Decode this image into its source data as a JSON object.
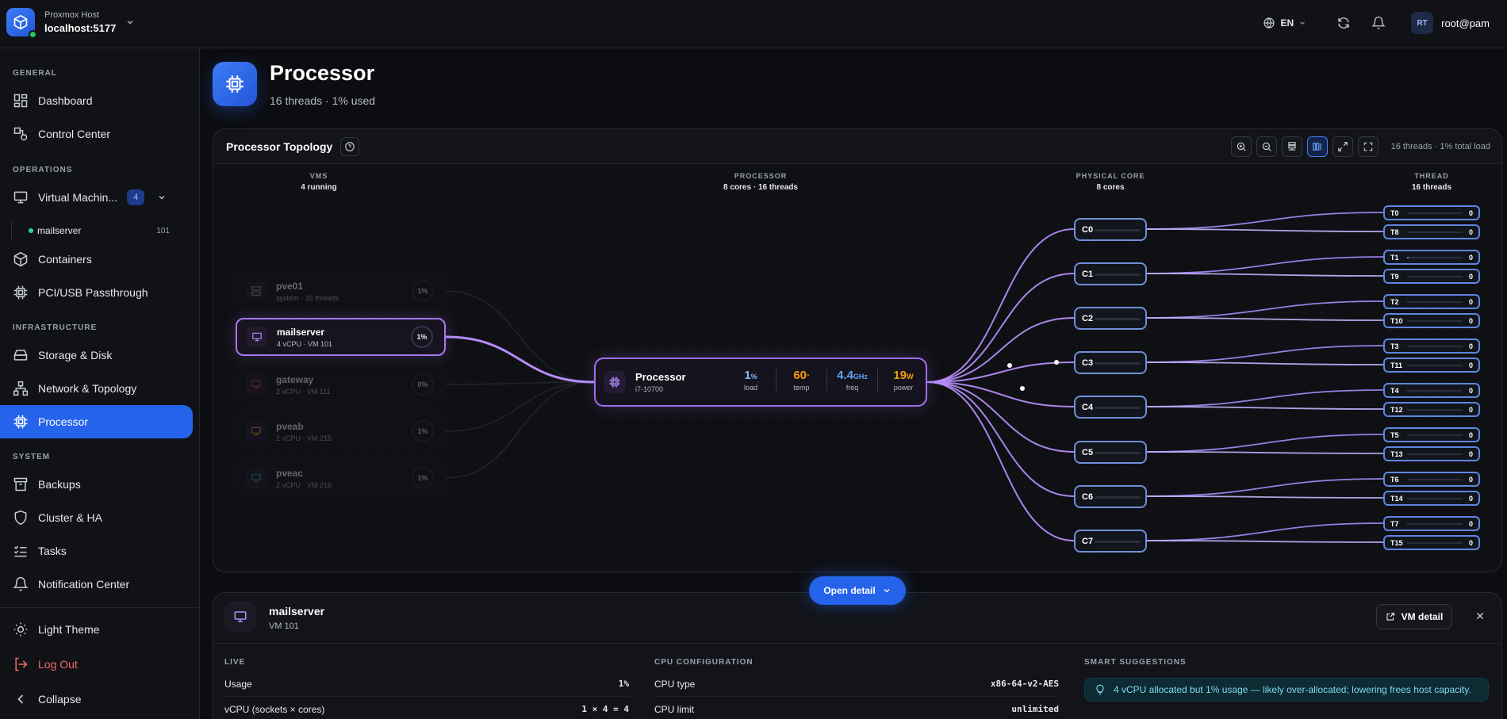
{
  "topbar": {
    "host_sub": "Proxmox Host",
    "host_name": "localhost:5177",
    "lang": "EN",
    "avatar": "RT",
    "user": "root@pam"
  },
  "sidebar": {
    "sections": {
      "general": "GENERAL",
      "operations": "OPERATIONS",
      "infrastructure": "INFRASTRUCTURE",
      "system": "SYSTEM"
    },
    "items": {
      "dashboard": "Dashboard",
      "control_center": "Control Center",
      "virtual_machines": "Virtual Machin...",
      "vm_count": "4",
      "mailserver": "mailserver",
      "mailserver_id": "101",
      "containers": "Containers",
      "pci": "PCI/USB Passthrough",
      "storage": "Storage & Disk",
      "network": "Network & Topology",
      "processor": "Processor",
      "backups": "Backups",
      "cluster": "Cluster & HA",
      "tasks": "Tasks",
      "notifications": "Notification Center"
    },
    "bottom": {
      "theme": "Light Theme",
      "logout": "Log Out",
      "collapse": "Collapse"
    }
  },
  "page": {
    "title": "Processor",
    "subtitle": "16 threads · 1% used"
  },
  "topology": {
    "title": "Processor Topology",
    "info": "16 threads · 1% total load",
    "columns": {
      "vms": "VMS",
      "vms_sub": "4 running",
      "processor": "PROCESSOR",
      "processor_sub": "8 cores · 16 threads",
      "core": "PHYSICAL CORE",
      "core_sub": "8 cores",
      "thread": "THREAD",
      "thread_sub": "16 threads"
    },
    "vms": [
      {
        "name": "pve01",
        "sub": "system · 16 threads",
        "pct": "1%"
      },
      {
        "name": "mailserver",
        "sub": "4 vCPU · VM 101",
        "pct": "1%"
      },
      {
        "name": "gateway",
        "sub": "2 vCPU · VM 111",
        "pct": "0%"
      },
      {
        "name": "pveab",
        "sub": "2 vCPU · VM 215",
        "pct": "1%"
      },
      {
        "name": "pveac",
        "sub": "2 vCPU · VM 216",
        "pct": "1%"
      }
    ],
    "processor": {
      "name": "Processor",
      "model": "i7-10700",
      "load": "1",
      "load_unit": "%",
      "load_label": "load",
      "temp": "60",
      "temp_unit": "°",
      "temp_label": "temp",
      "freq": "4.4",
      "freq_unit": "GHz",
      "freq_label": "freq",
      "power": "19",
      "power_unit": "W",
      "power_label": "power"
    },
    "cores": [
      "C0",
      "C1",
      "C2",
      "C3",
      "C4",
      "C5",
      "C6",
      "C7"
    ],
    "threads": [
      {
        "name": "T0",
        "value": "0"
      },
      {
        "name": "T8",
        "value": "0"
      },
      {
        "name": "T1",
        "value": "0"
      },
      {
        "name": "T9",
        "value": "0"
      },
      {
        "name": "T2",
        "value": "0"
      },
      {
        "name": "T10",
        "value": "0"
      },
      {
        "name": "T3",
        "value": "0"
      },
      {
        "name": "T11",
        "value": "0"
      },
      {
        "name": "T4",
        "value": "0"
      },
      {
        "name": "T12",
        "value": "0"
      },
      {
        "name": "T5",
        "value": "0"
      },
      {
        "name": "T13",
        "value": "0"
      },
      {
        "name": "T6",
        "value": "0"
      },
      {
        "name": "T14",
        "value": "0"
      },
      {
        "name": "T7",
        "value": "0"
      },
      {
        "name": "T15",
        "value": "0"
      }
    ]
  },
  "open_detail": "Open detail",
  "detail": {
    "name": "mailserver",
    "sub": "VM 101",
    "vm_button": "VM detail",
    "live_h": "LIVE",
    "usage_label": "Usage",
    "usage_value": "1%",
    "vcpu_label": "vCPU (sockets × cores)",
    "vcpu_value": "1 × 4 = 4",
    "config_h": "CPU CONFIGURATION",
    "cputype_label": "CPU type",
    "cputype_value": "x86-64-v2-AES",
    "cpulimit_label": "CPU limit",
    "cpulimit_value": "unlimited",
    "smart_h": "SMART SUGGESTIONS",
    "suggestion": "4 vCPU allocated but 1% usage — likely over-allocated; lowering frees host capacity."
  },
  "colors": {
    "accent": "#2563eb",
    "purple": "#a678f0",
    "orange": "#f59e0b",
    "blue": "#60a5fa"
  }
}
